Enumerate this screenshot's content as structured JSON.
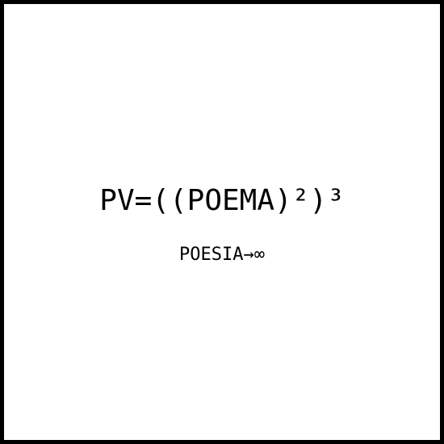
{
  "artwork": {
    "formula": "PV=((POEMA)²)³",
    "subtitle": "POESIA→∞"
  },
  "colors": {
    "border": "#000000",
    "background": "#ffffff",
    "text": "#000000"
  }
}
